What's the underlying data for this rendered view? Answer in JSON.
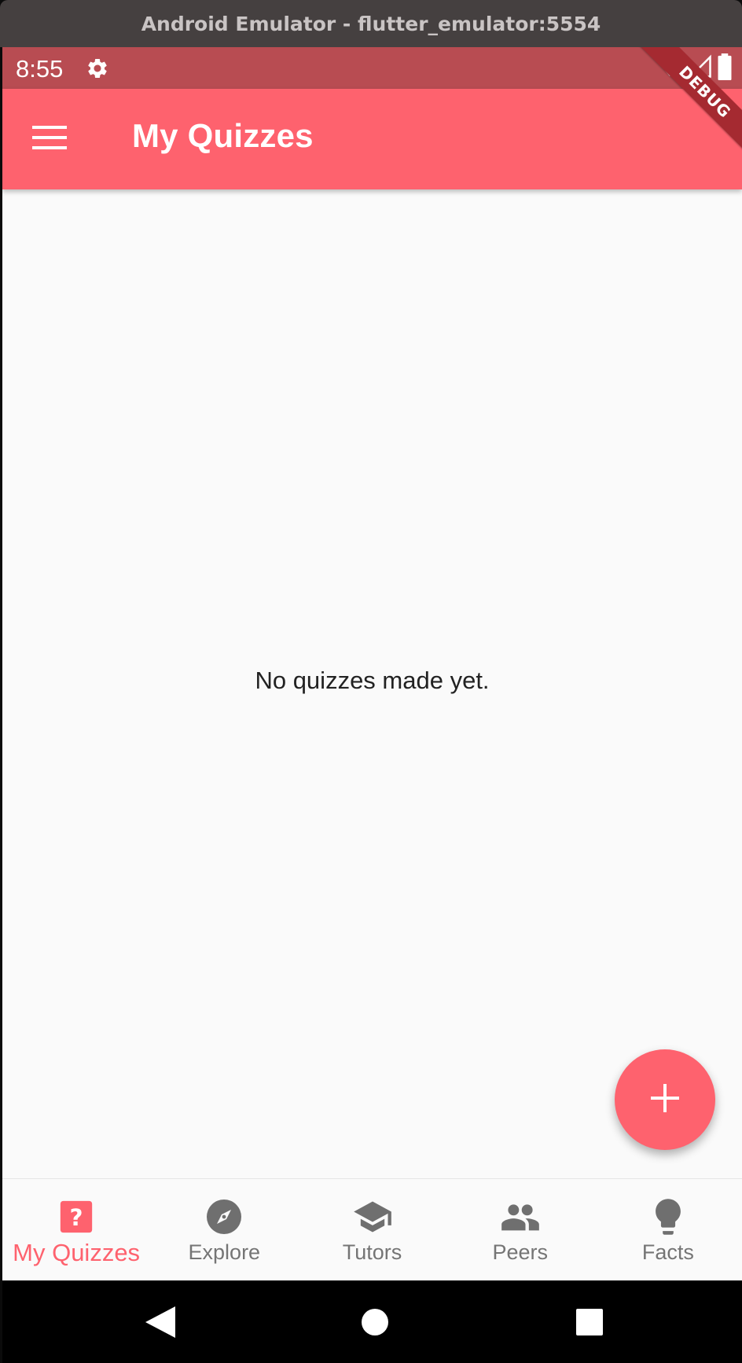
{
  "window": {
    "title": "Android Emulator - flutter_emulator:5554"
  },
  "statusbar": {
    "time": "8:55",
    "icons": [
      "settings-gear-icon",
      "wifi-icon",
      "signal-icon",
      "battery-icon"
    ]
  },
  "debug_banner": "DEBUG",
  "appbar": {
    "title": "My Quizzes",
    "menu_icon": "hamburger-menu-icon"
  },
  "content": {
    "empty_message": "No quizzes made yet."
  },
  "fab": {
    "icon": "plus-icon"
  },
  "bottom_nav": {
    "items": [
      {
        "label": "My Quizzes",
        "icon": "quiz-question-icon",
        "active": true
      },
      {
        "label": "Explore",
        "icon": "compass-icon",
        "active": false
      },
      {
        "label": "Tutors",
        "icon": "school-cap-icon",
        "active": false
      },
      {
        "label": "Peers",
        "icon": "people-icon",
        "active": false
      },
      {
        "label": "Facts",
        "icon": "lightbulb-icon",
        "active": false
      }
    ]
  },
  "colors": {
    "accent": "#fe626e",
    "statusbar": "#b84c52",
    "inactive": "#757575",
    "background": "#fafafa"
  },
  "system_nav": {
    "icons": [
      "back-icon",
      "home-icon",
      "recents-icon"
    ]
  }
}
